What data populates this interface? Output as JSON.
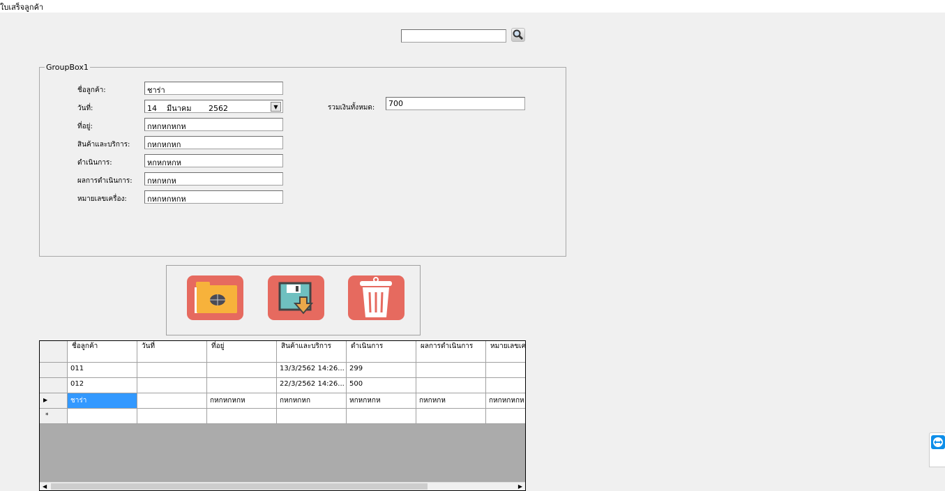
{
  "window": {
    "title": "ใบเสร็จลูกค้า"
  },
  "search": {
    "value": "",
    "icon": "search-icon"
  },
  "group": {
    "title": "GroupBox1",
    "fields": [
      {
        "label": "ชื่อลูกค้า:",
        "value": "ชาร่า"
      },
      {
        "label": "วันที่:",
        "value": "14    มีนาคม       2562"
      },
      {
        "label": "ที่อยู่:",
        "value": "กหกหกหกห"
      },
      {
        "label": "สินค้าและบริการ:",
        "value": "กหกหกหก"
      },
      {
        "label": "ดำเนินการ:",
        "value": "หกหกหกห"
      },
      {
        "label": "ผลการดำเนินการ:",
        "value": "กหกหกห"
      },
      {
        "label": "หมายเลขเครื่อง:",
        "value": "กหกหกหกห"
      }
    ],
    "total": {
      "label": "รวมเงินทั้งหมด:",
      "value": "700"
    }
  },
  "buttons": {
    "open": "folder-icon",
    "save": "save-icon",
    "delete": "trash-icon"
  },
  "grid": {
    "columns": [
      "ชื่อลูกค้า",
      "วันที่",
      "ที่อยู่",
      "สินค้าและบริการ",
      "ดำเนินการ",
      "ผลการดำเนินการ",
      "หมายเลขเครื่อง"
    ],
    "rows": [
      [
        "011",
        "",
        "",
        "13/3/2562 14:26...",
        "299",
        "",
        ""
      ],
      [
        "012",
        "",
        "",
        "22/3/2562 14:26...",
        "500",
        "",
        ""
      ],
      [
        "ชาร่า",
        "",
        "กหกหกหกห",
        "กหกหกหก",
        "หกหกหกห",
        "กหกหกห",
        "กหกหกหกห"
      ]
    ],
    "new_row_marker": "*"
  }
}
